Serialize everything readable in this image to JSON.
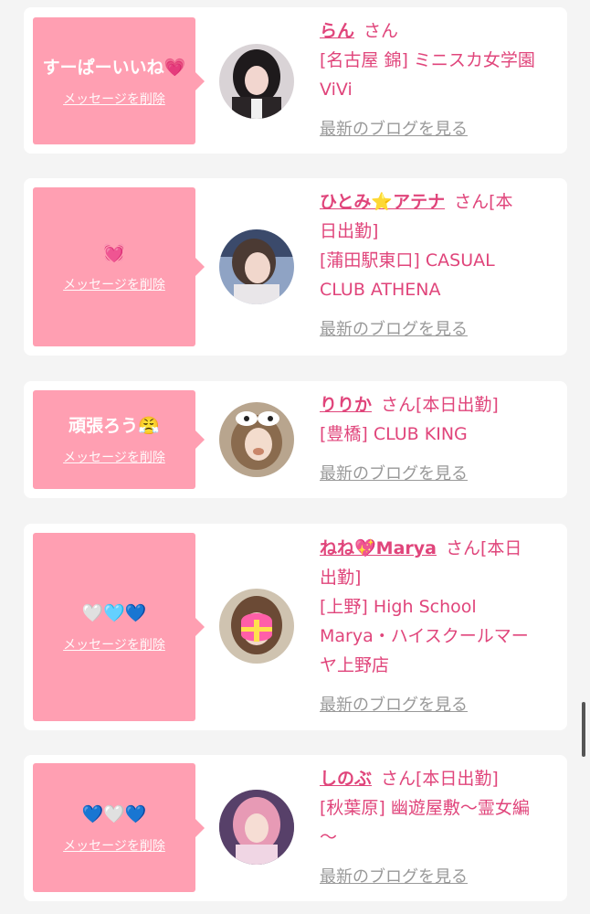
{
  "colors": {
    "accent": "#e0457b",
    "bubble": "#ff9fb2",
    "muted": "#999999",
    "background": "#f4f4f4",
    "card": "#ffffff"
  },
  "cards": [
    {
      "message": "すーぱーいいね💗",
      "delete_label": "メッセージを削除",
      "name": "らん",
      "san": "さん",
      "shop_lines": [
        "[名古屋 錦] ミニスカ女学園",
        "ViVi"
      ],
      "blog_label": "最新のブログを見る"
    },
    {
      "message": "💓",
      "delete_label": "メッセージを削除",
      "name": "ひとみ⭐アテナ",
      "san": "さん[本",
      "shop_lines": [
        "日出勤]",
        "[蒲田駅東口] CASUAL",
        "CLUB ATHENA"
      ],
      "blog_label": "最新のブログを見る"
    },
    {
      "message": "頑張ろう😤",
      "delete_label": "メッセージを削除",
      "name": "りりか",
      "san": "さん[本日出勤]",
      "shop_lines": [
        "[豊橋] CLUB KING"
      ],
      "blog_label": "最新のブログを見る"
    },
    {
      "message": "🤍🩵💙",
      "delete_label": "メッセージを削除",
      "name": "ねね💖Marya",
      "san": "さん[本日",
      "shop_lines": [
        "出勤]",
        "[上野] High School",
        "Marya・ハイスクールマー",
        "ヤ上野店"
      ],
      "blog_label": "最新のブログを見る"
    },
    {
      "message": "💙🤍💙",
      "delete_label": "メッセージを削除",
      "name": "しのぶ",
      "san": "さん[本日出勤]",
      "shop_lines": [
        "[秋葉原] 幽遊屋敷〜霊女編",
        "〜"
      ],
      "blog_label": "最新のブログを見る"
    }
  ]
}
